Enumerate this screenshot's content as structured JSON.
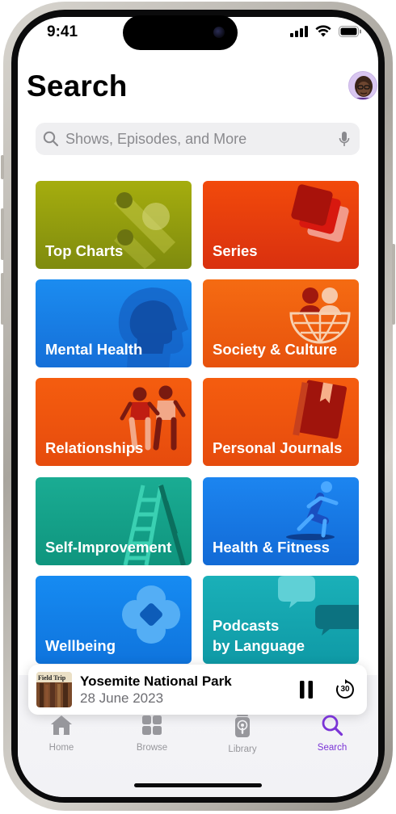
{
  "status_bar": {
    "time": "9:41"
  },
  "header": {
    "title": "Search"
  },
  "search": {
    "placeholder": "Shows, Episodes, and More"
  },
  "categories": [
    {
      "label": "Top Charts",
      "color": "#8f9a12",
      "icon": "top-charts-art"
    },
    {
      "label": "Series",
      "color": "#e9340c",
      "icon": "stacked-squares-art"
    },
    {
      "label": "Mental Health",
      "color": "#1a7fe6",
      "icon": "head-silhouette-art"
    },
    {
      "label": "Society & Culture",
      "color": "#f0620f",
      "icon": "people-globe-art"
    },
    {
      "label": "Relationships",
      "color": "#f0560f",
      "icon": "two-people-art"
    },
    {
      "label": "Personal Journals",
      "color": "#f0560f",
      "icon": "journal-book-art"
    },
    {
      "label": "Self-Improvement",
      "color": "#17a88c",
      "icon": "ladder-art"
    },
    {
      "label": "Health & Fitness",
      "color": "#1877e6",
      "icon": "runner-art"
    },
    {
      "label": "Wellbeing",
      "color": "#1380e8",
      "icon": "flower-art"
    },
    {
      "label": "Podcasts\nby Language",
      "color": "#1aaab3",
      "icon": "speech-bubbles-art"
    }
  ],
  "player": {
    "title": "Yosemite National Park",
    "date": "28 June 2023",
    "cover_text": "Field Trip",
    "skip_seconds": "30"
  },
  "tabs": [
    {
      "label": "Home",
      "icon": "home-icon",
      "active": false
    },
    {
      "label": "Browse",
      "icon": "browse-grid-icon",
      "active": false
    },
    {
      "label": "Library",
      "icon": "library-podcast-icon",
      "active": false
    },
    {
      "label": "Search",
      "icon": "search-icon",
      "active": true
    }
  ],
  "colors": {
    "accent": "#7a34d6",
    "tab_inactive": "#97979c"
  }
}
